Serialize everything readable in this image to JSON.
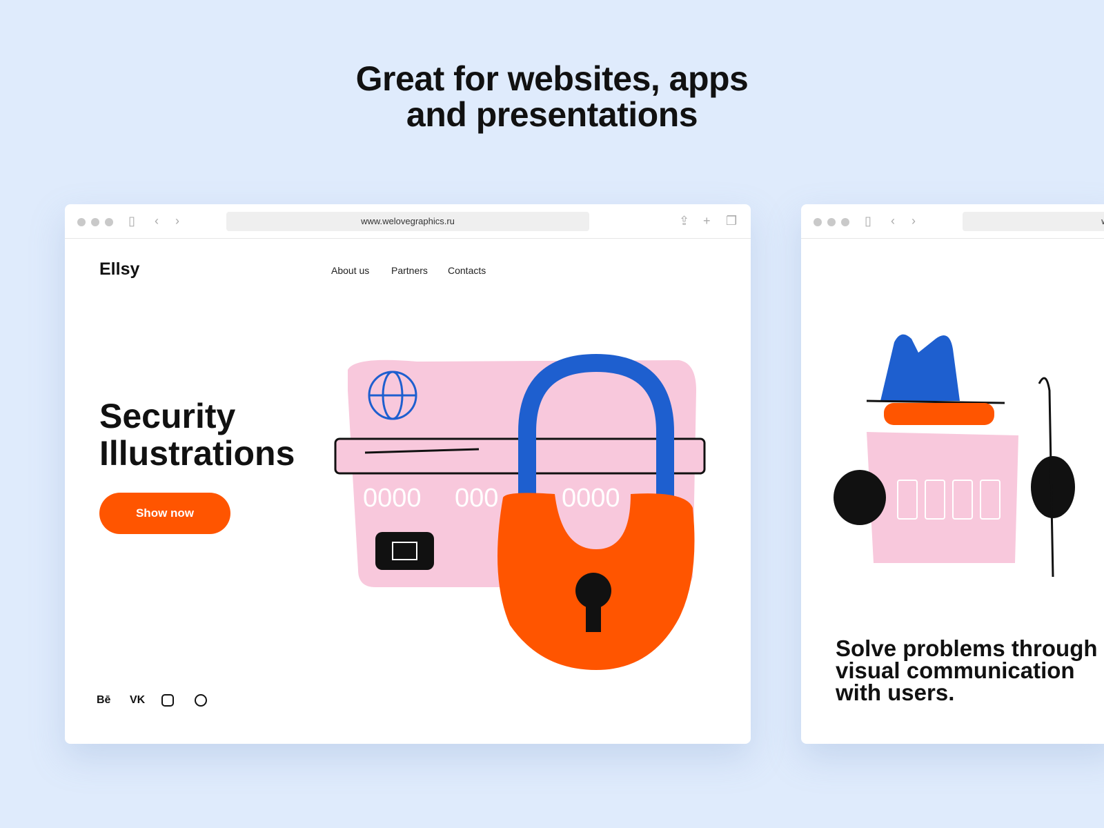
{
  "headline": [
    "Great for websites, apps",
    "and presentations"
  ],
  "browser1": {
    "url": "www.welovegraphics.ru",
    "logo": "Ellsy",
    "nav": [
      "About us",
      "Partners",
      "Contacts"
    ],
    "hero": [
      "Security",
      "Illustrations"
    ],
    "button": "Show now",
    "social": [
      "Bē",
      "VK",
      "instagram-icon",
      "dribbble-icon"
    ],
    "card_numbers": [
      "0000",
      "000",
      "0000"
    ]
  },
  "browser2": {
    "url": "ww",
    "tagline": "Solve problems through visual communication with users."
  },
  "colors": {
    "accent": "#ff5500",
    "blue": "#1e5fcf",
    "pink": "#f8c8dc",
    "background": "#dfebfc"
  }
}
